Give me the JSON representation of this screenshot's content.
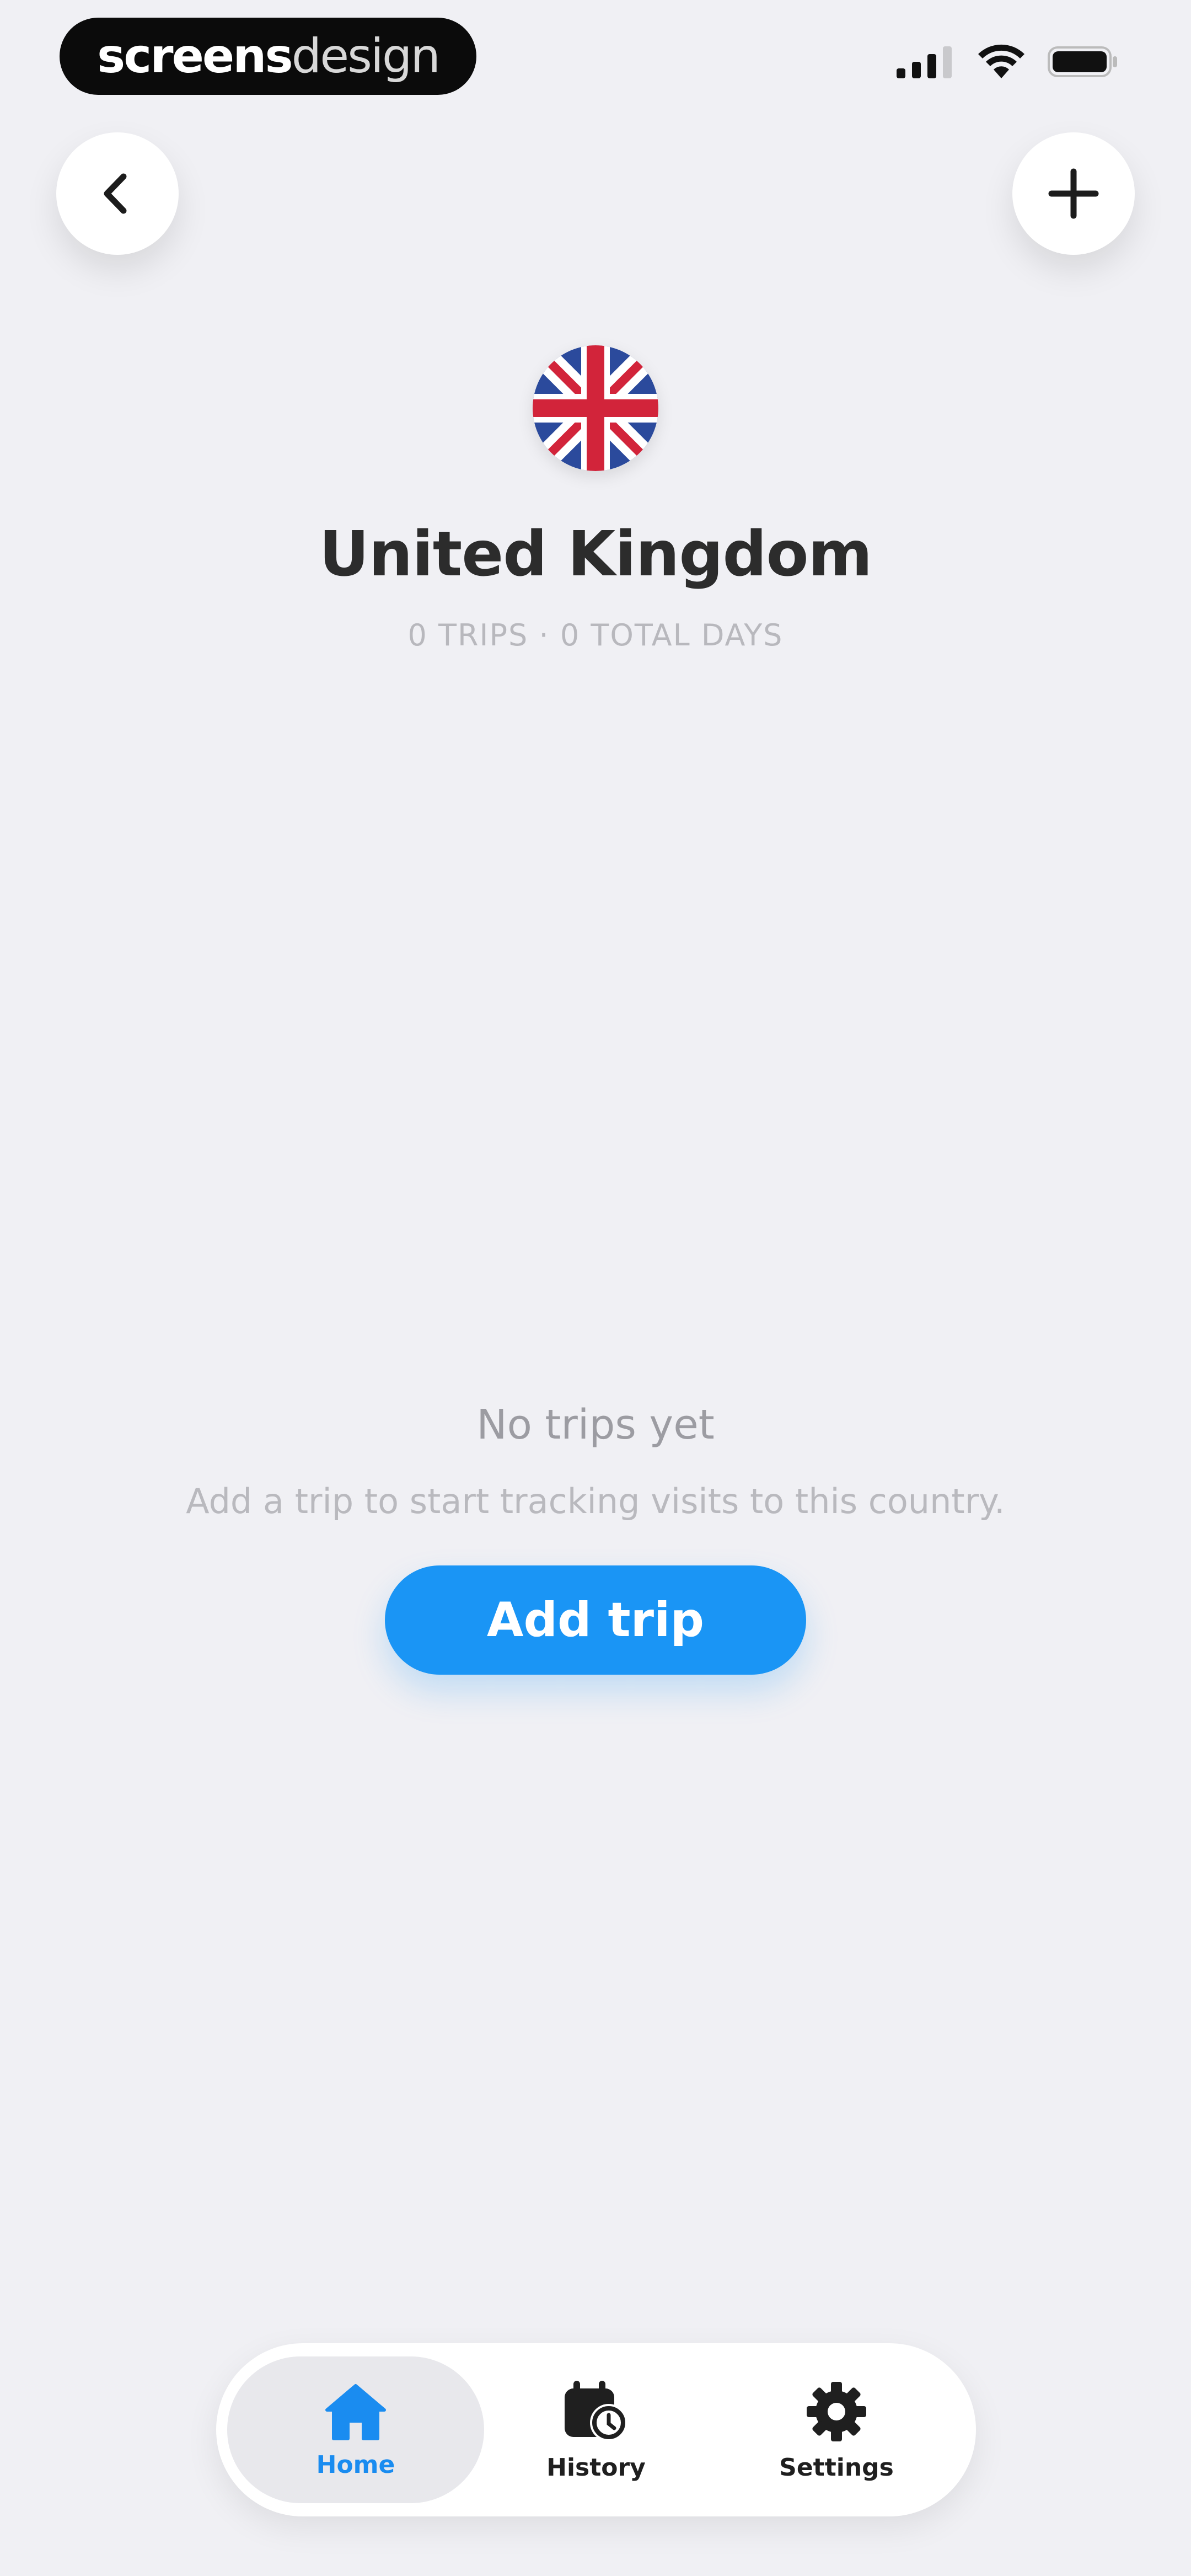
{
  "status_bar": {
    "brand_bold": "screens",
    "brand_light": "design",
    "signal_icon": "cellular-signal-icon",
    "wifi_icon": "wifi-icon",
    "battery_icon": "battery-icon"
  },
  "header": {
    "back_icon": "chevron-left-icon",
    "add_icon": "plus-icon"
  },
  "country": {
    "name": "United Kingdom",
    "flag_icon": "uk-flag-icon",
    "stats": "0 TRIPS · 0 TOTAL DAYS"
  },
  "empty_state": {
    "title": "No trips yet",
    "description": "Add a trip to start tracking visits to this country.",
    "button_label": "Add trip"
  },
  "tab_bar": {
    "items": [
      {
        "label": "Home",
        "icon": "home-icon",
        "active": true
      },
      {
        "label": "History",
        "icon": "calendar-clock-icon",
        "active": false
      },
      {
        "label": "Settings",
        "icon": "gear-icon",
        "active": false
      }
    ]
  },
  "colors": {
    "background": "#f0f0f4",
    "accent": "#1a95f5",
    "title": "#2c2c2c",
    "muted": "#b8b8bd"
  }
}
